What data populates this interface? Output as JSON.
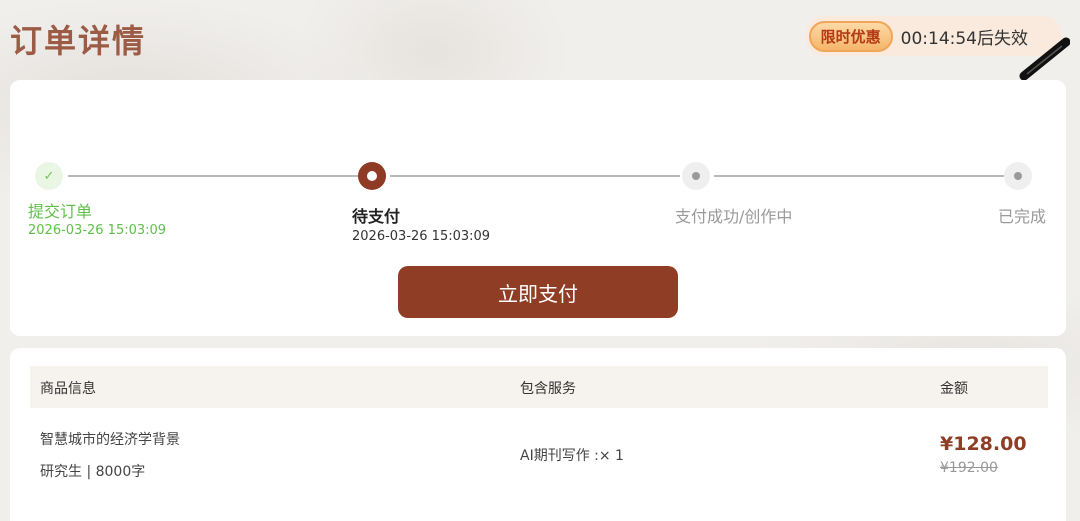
{
  "header": {
    "title": "订单详情",
    "promo_badge": "限时优惠",
    "promo_countdown": "00:14:54后失效"
  },
  "steps": [
    {
      "label": "提交订单",
      "time": "2026-03-26 15:03:09",
      "state": "done"
    },
    {
      "label": "待支付",
      "time": "2026-03-26 15:03:09",
      "state": "current"
    },
    {
      "label": "支付成功/创作中",
      "time": "",
      "state": "pending"
    },
    {
      "label": "已完成",
      "time": "",
      "state": "pending"
    }
  ],
  "pay_button_label": "立即支付",
  "order_table": {
    "headers": {
      "product": "商品信息",
      "service": "包含服务",
      "amount": "金额"
    },
    "row": {
      "product_title": "智慧城市的经济学背景",
      "product_meta": "研究生 | 8000字",
      "service": "AI期刊写作 :× 1",
      "price": "¥128.00",
      "original_price": "¥192.00"
    }
  },
  "colors": {
    "brand": "#8f3d25",
    "done_green": "#72c25a",
    "title": "#9b5b45"
  }
}
